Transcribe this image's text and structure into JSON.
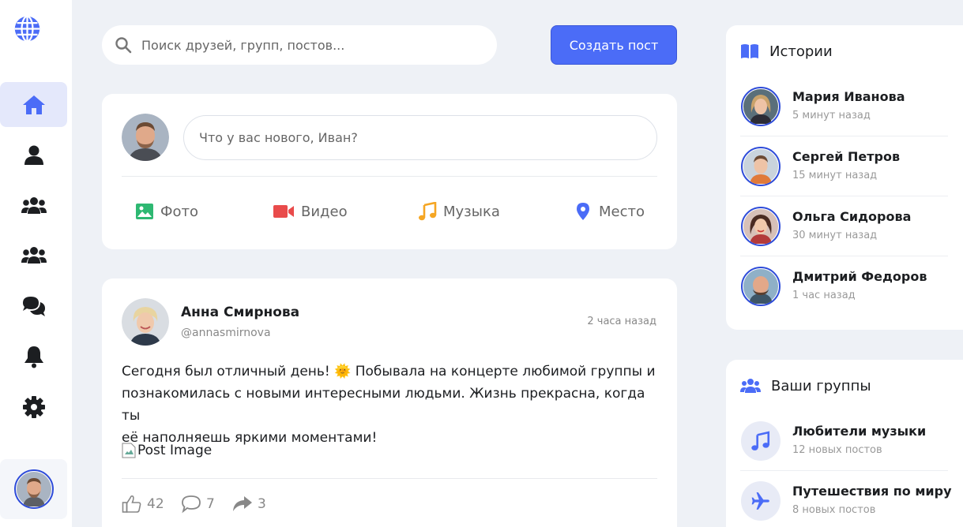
{
  "colors": {
    "accent": "#4b6cf7",
    "page_bg": "#eef1f6",
    "icon_dark": "#1c1e21"
  },
  "sidebar": {
    "logo_icon": "globe-icon",
    "items": [
      {
        "icon": "home-icon",
        "active": true
      },
      {
        "icon": "user-icon"
      },
      {
        "icon": "friends-icon"
      },
      {
        "icon": "groups-icon"
      },
      {
        "icon": "chat-icon"
      },
      {
        "icon": "bell-icon"
      },
      {
        "icon": "gear-icon"
      }
    ]
  },
  "header": {
    "search_placeholder": "Поиск друзей, групп, постов...",
    "create_post_label": "Создать пост"
  },
  "composer": {
    "placeholder": "Что у вас нового, Иван?",
    "actions": [
      {
        "icon": "photo-icon",
        "label": "Фото",
        "color": "#2eb872"
      },
      {
        "icon": "video-icon",
        "label": "Видео",
        "color": "#e94b4b"
      },
      {
        "icon": "music-icon",
        "label": "Музыка",
        "color": "#f5a623"
      },
      {
        "icon": "location-icon",
        "label": "Место",
        "color": "#4b6cf7"
      }
    ]
  },
  "post": {
    "author_name": "Анна Смирнова",
    "author_handle": "@annasmirnova",
    "time": "2 часа назад",
    "text_lines": [
      "Сегодня был отличный день! 🌞 Побывала на концерте любимой группы и",
      "познакомилась с новыми интересными людьми. Жизнь прекрасна, когда ты",
      "её наполняешь яркими моментами!"
    ],
    "image_alt": "Post Image",
    "likes": "42",
    "comments": "7",
    "shares": "3"
  },
  "stories": {
    "title": "Истории",
    "items": [
      {
        "name": "Мария Иванова",
        "time": "5 минут назад"
      },
      {
        "name": "Сергей Петров",
        "time": "15 минут назад"
      },
      {
        "name": "Ольга Сидорова",
        "time": "30 минут назад"
      },
      {
        "name": "Дмитрий Федоров",
        "time": "1 час назад"
      }
    ]
  },
  "groups": {
    "title": "Ваши группы",
    "items": [
      {
        "icon": "music-note-icon",
        "name": "Любители музыки",
        "meta": "12 новых постов"
      },
      {
        "icon": "plane-icon",
        "name": "Путешествия по миру",
        "meta": "8 новых постов"
      }
    ]
  }
}
